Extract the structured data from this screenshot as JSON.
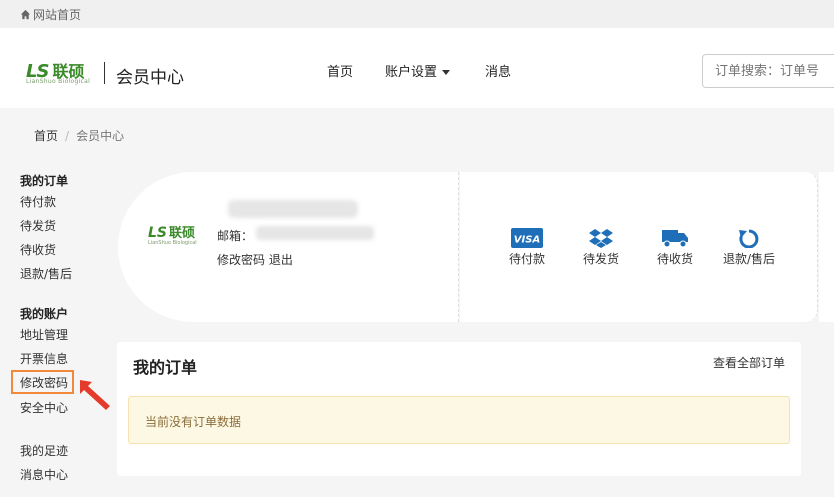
{
  "topbar": {
    "home_label": "网站首页"
  },
  "header": {
    "logo_mark": "LS",
    "logo_cn": "联硕",
    "logo_sub": "LianShuo Biological",
    "title": "会员中心",
    "nav": [
      {
        "label": "首页"
      },
      {
        "label": "账户设置"
      },
      {
        "label": "消息"
      }
    ],
    "search_placeholder": "订单搜索：订单号"
  },
  "breadcrumb": {
    "home": "首页",
    "current": "会员中心"
  },
  "sidebar": {
    "orders_heading": "我的订单",
    "orders_items": [
      "待付款",
      "待发货",
      "待收货",
      "退款/售后"
    ],
    "account_heading": "我的账户",
    "account_items": [
      "地址管理",
      "开票信息",
      "修改密码",
      "安全中心"
    ],
    "extra_items": [
      "我的足迹",
      "消息中心"
    ]
  },
  "profile": {
    "email_label": "邮箱：",
    "change_password": "修改密码",
    "logout": "退出"
  },
  "order_status": [
    {
      "label": "待付款",
      "icon": "visa-card-icon"
    },
    {
      "label": "待发货",
      "icon": "dropbox-icon"
    },
    {
      "label": "待收货",
      "icon": "truck-icon"
    },
    {
      "label": "退款/售后",
      "icon": "refresh-icon"
    }
  ],
  "orders_panel": {
    "title": "我的订单",
    "view_all": "查看全部订单",
    "empty_message": "当前没有订单数据"
  },
  "colors": {
    "accent_blue": "#1f6fb8",
    "brand_green": "#3a8a2a",
    "highlight_orange": "#f08a3a",
    "arrow_red": "#e53b2c",
    "alert_bg": "#fcf8e3",
    "alert_text": "#8a6d3b"
  }
}
